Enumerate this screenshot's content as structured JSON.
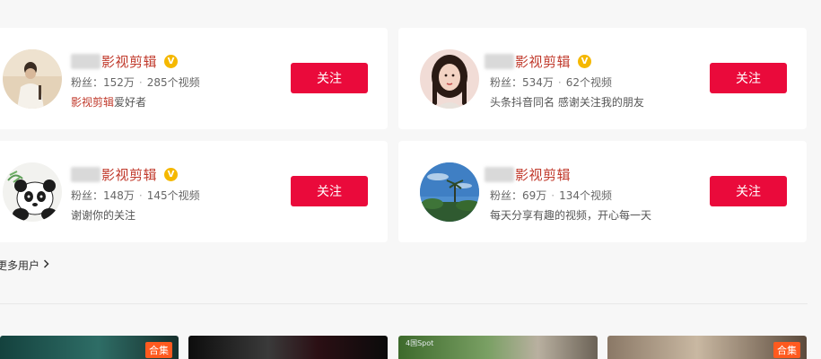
{
  "users": [
    {
      "name": "影视剪辑",
      "fans": "粉丝：152万",
      "videos": "285个视频",
      "desc_highlight": "影视剪辑",
      "desc_rest": "爱好者",
      "desc": "",
      "follow_label": "关注",
      "verified": "V"
    },
    {
      "name": "影视剪辑",
      "fans": "粉丝：534万",
      "videos": "62个视频",
      "desc_highlight": "",
      "desc_rest": "",
      "desc": "头条抖音同名 感谢关注我的朋友",
      "follow_label": "关注",
      "verified": "V"
    },
    {
      "name": "影视剪辑",
      "fans": "粉丝：148万",
      "videos": "145个视频",
      "desc_highlight": "",
      "desc_rest": "",
      "desc": "谢谢你的关注",
      "follow_label": "关注",
      "verified": "V"
    },
    {
      "name": "影视剪辑",
      "fans": "粉丝：69万",
      "videos": "134个视频",
      "desc_highlight": "",
      "desc_rest": "",
      "desc": "每天分享有趣的视频，开心每一天",
      "follow_label": "关注",
      "verified": ""
    }
  ],
  "more_users_label": "更多用户",
  "stat_separator": "·",
  "thumbnails": [
    {
      "tag": "合集"
    },
    {
      "tag": ""
    },
    {
      "tag": "",
      "caption": "4国Spot"
    },
    {
      "tag": "合集"
    }
  ],
  "colors": {
    "accent": "#ea0a3b",
    "name": "#c0392b",
    "badge": "#f5b800",
    "tag": "#ff5a1f"
  }
}
